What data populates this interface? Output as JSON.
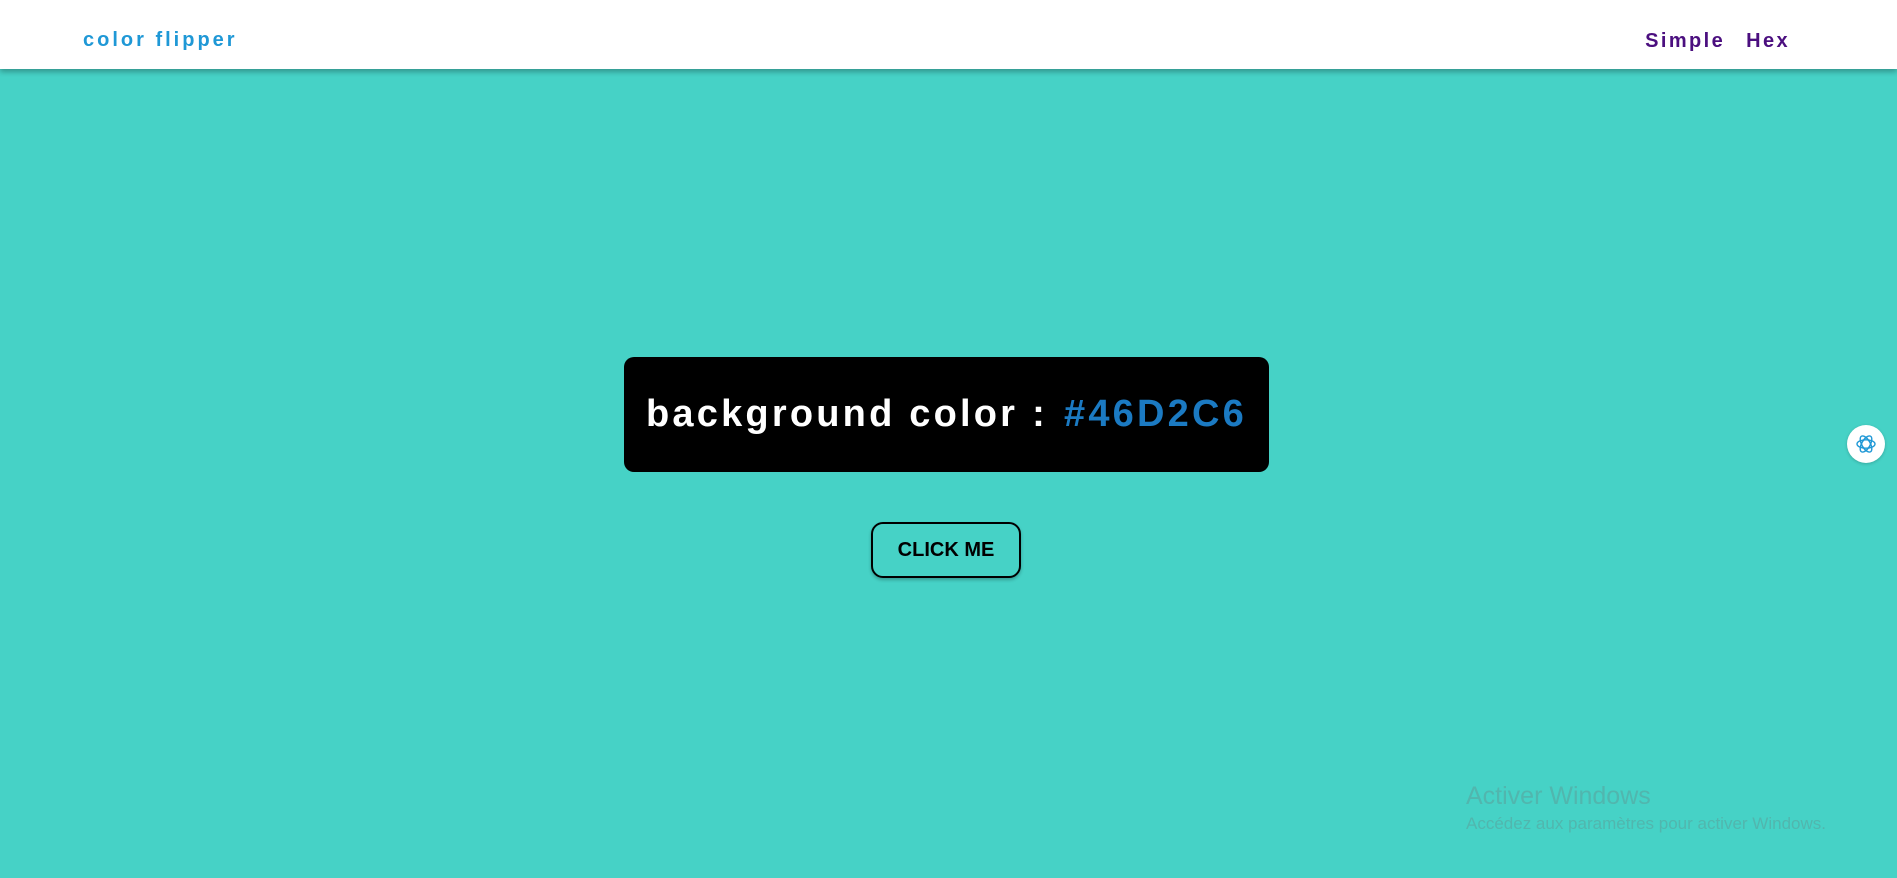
{
  "navbar": {
    "brand": "color flipper",
    "links": [
      {
        "label": "Simple"
      },
      {
        "label": "Hex"
      }
    ]
  },
  "main": {
    "label": "background color",
    "separator": ":",
    "value": "#46D2C6",
    "button_label": "CLICK ME"
  },
  "colors": {
    "background": "#46D2C6",
    "brand": "#1f98d6",
    "nav_links": "#4b0f7f",
    "value_text": "#1b7ac2",
    "panel": "#000000"
  },
  "extension": {
    "icon": "openai-logo-icon"
  },
  "watermark": {
    "title": "Activer Windows",
    "subtitle": "Accédez aux paramètres pour activer Windows."
  }
}
